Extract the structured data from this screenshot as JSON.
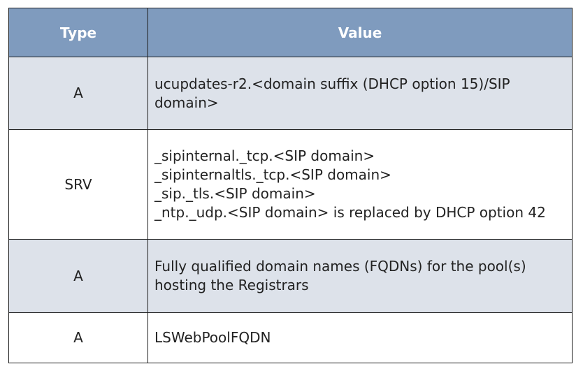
{
  "table": {
    "headers": {
      "type": "Type",
      "value": "Value"
    },
    "rows": [
      {
        "type": "A",
        "value_lines": [
          "ucupdates-r2.<domain suffix (DHCP option 15)/SIP",
          "domain>"
        ]
      },
      {
        "type": "SRV",
        "value_lines": [
          "_sipinternal._tcp.<SIP domain>",
          "_sipinternaltls._tcp.<SIP domain>",
          "_sip._tls.<SIP domain>",
          "_ntp._udp.<SIP domain> is replaced by DHCP option 42"
        ]
      },
      {
        "type": "A",
        "value_lines": [
          "Fully qualified domain names (FQDNs) for the pool(s)",
          "hosting the Registrars"
        ]
      },
      {
        "type": "A",
        "value_lines": [
          "LSWebPoolFQDN"
        ]
      }
    ]
  },
  "colors": {
    "header_background": "#7f9bbe",
    "header_text": "#ffffff",
    "shaded_row": "#dde2ea",
    "plain_row": "#ffffff",
    "border": "#1e1e1e"
  }
}
